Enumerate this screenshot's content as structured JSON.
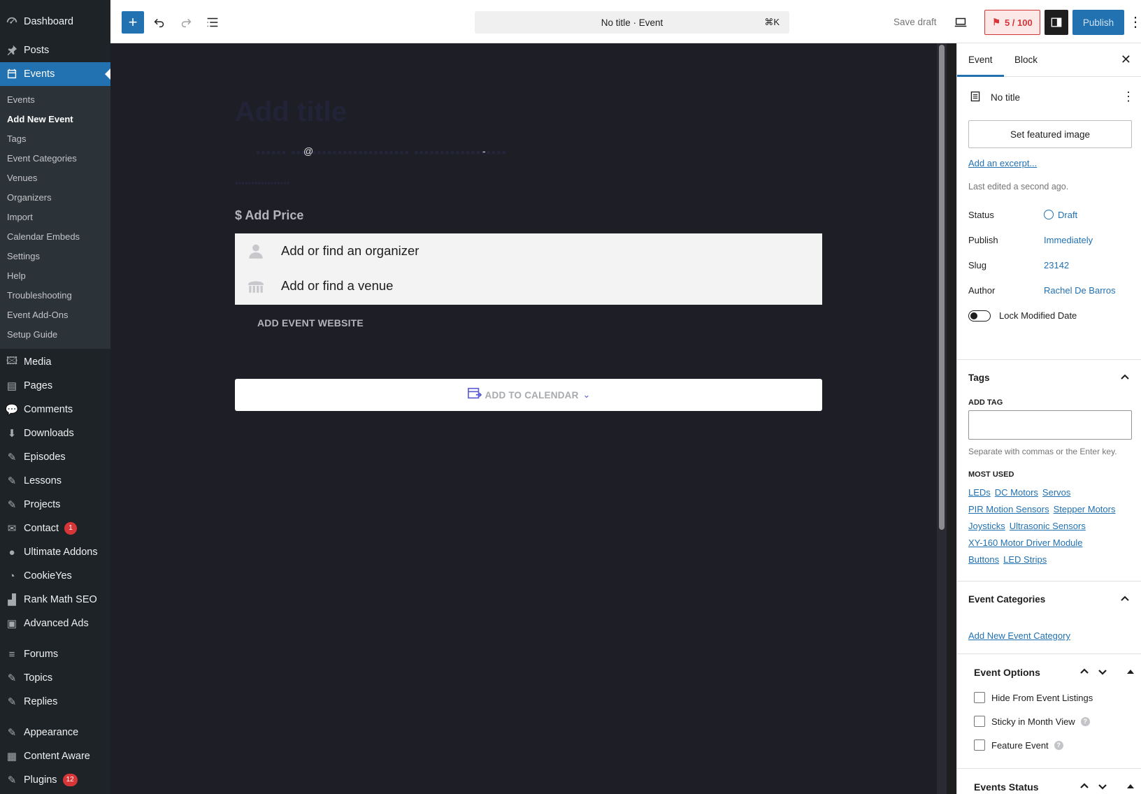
{
  "admin_menu": {
    "top_items": [
      {
        "label": "Dashboard",
        "icon": "dashboard-icon"
      },
      {
        "label": "Posts",
        "icon": "pin-icon"
      },
      {
        "label": "Events",
        "icon": "calendar-icon"
      }
    ],
    "events_submenu": [
      "Events",
      "Add New Event",
      "Tags",
      "Event Categories",
      "Venues",
      "Organizers",
      "Import",
      "Calendar Embeds",
      "Settings",
      "Help",
      "Troubleshooting",
      "Event Add-Ons",
      "Setup Guide"
    ],
    "bottom_items": [
      {
        "label": "Media"
      },
      {
        "label": "Pages"
      },
      {
        "label": "Comments"
      },
      {
        "label": "Downloads"
      },
      {
        "label": "Episodes"
      },
      {
        "label": "Lessons"
      },
      {
        "label": "Projects"
      },
      {
        "label": "Contact",
        "badge": "1"
      },
      {
        "label": "Ultimate Addons"
      },
      {
        "label": "CookieYes"
      },
      {
        "label": "Rank Math SEO"
      },
      {
        "label": "Advanced Ads"
      },
      {
        "label": "Forums"
      },
      {
        "label": "Topics"
      },
      {
        "label": "Replies"
      },
      {
        "label": "Appearance"
      },
      {
        "label": "Content Aware"
      },
      {
        "label": "Plugins",
        "badge": "12"
      }
    ]
  },
  "toolbar": {
    "doc_title": "No title · Event",
    "shortcut": "⌘K",
    "save_draft": "Save draft",
    "score": "5 / 100",
    "publish": "Publish"
  },
  "canvas": {
    "title_placeholder": "Add title",
    "at_symbol": "@",
    "dash": "-",
    "add_price": "$ Add Price",
    "organizer_placeholder": "Add or find an organizer",
    "venue_placeholder": "Add or find a venue",
    "event_website": "ADD EVENT WEBSITE",
    "add_to_calendar": "ADD TO CALENDAR"
  },
  "sidebar": {
    "tabs": [
      "Event",
      "Block"
    ],
    "post_title": "No title",
    "featured_image": "Set featured image",
    "add_excerpt": "Add an excerpt...",
    "last_edited": "Last edited a second ago.",
    "fields": [
      {
        "label": "Status",
        "value": "Draft"
      },
      {
        "label": "Publish",
        "value": "Immediately"
      },
      {
        "label": "Slug",
        "value": "23142"
      },
      {
        "label": "Author",
        "value": "Rachel De Barros"
      }
    ],
    "lock_modified": "Lock Modified Date",
    "tags": {
      "heading": "Tags",
      "add_tag_label": "ADD TAG",
      "help": "Separate with commas or the Enter key.",
      "most_used_label": "MOST USED",
      "rows": [
        [
          "LEDs",
          "DC Motors",
          "Servos"
        ],
        [
          "PIR Motion Sensors",
          "Stepper Motors"
        ],
        [
          "Joysticks",
          "Ultrasonic Sensors"
        ],
        [
          "XY-160 Motor Driver Module"
        ],
        [
          "Buttons",
          "LED Strips"
        ]
      ]
    },
    "event_categories": {
      "heading": "Event Categories",
      "add_new": "Add New Event Category"
    },
    "event_options": {
      "heading": "Event Options",
      "options": [
        "Hide From Event Listings",
        "Sticky in Month View",
        "Feature Event"
      ]
    },
    "events_status": {
      "heading": "Events Status"
    }
  },
  "colors": {
    "accent": "#2271b1",
    "admin_bg": "#1d2327",
    "canvas_bg": "#1e1e27",
    "badge": "#d63638"
  }
}
